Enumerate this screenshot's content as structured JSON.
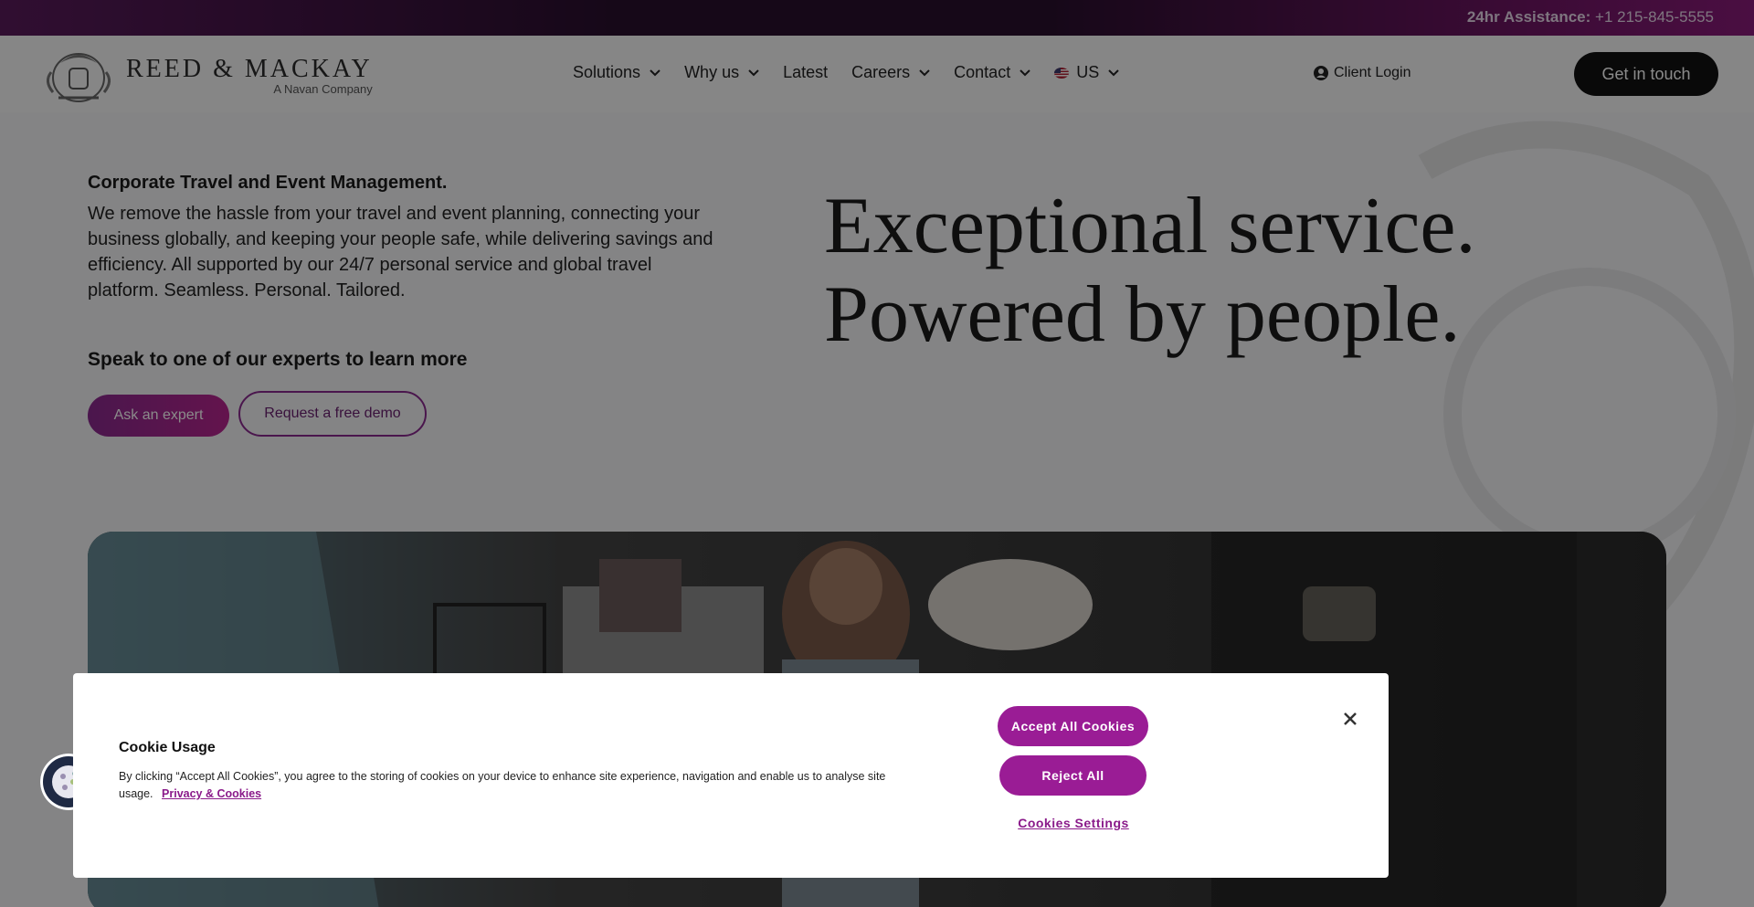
{
  "topbar": {
    "assist_label": "24hr Assistance:",
    "phone": "+1 215-845-5555"
  },
  "header": {
    "brand_name": "REED & MACKAY",
    "brand_sub": "A Navan Company",
    "nav": [
      {
        "label": "Solutions",
        "has_dropdown": true
      },
      {
        "label": "Why us",
        "has_dropdown": true
      },
      {
        "label": "Latest",
        "has_dropdown": false
      },
      {
        "label": "Careers",
        "has_dropdown": true
      },
      {
        "label": "Contact",
        "has_dropdown": true
      },
      {
        "label": "US",
        "has_dropdown": true,
        "icon": "us-flag-icon"
      }
    ],
    "client_login": "Client Login",
    "cta": "Get in touch"
  },
  "hero": {
    "kicker": "Corporate Travel and Event Management.",
    "intro": "We remove the hassle from your travel and event planning, connecting your business globally, and keeping your people safe, while delivering savings and efficiency. All supported by our 24/7 personal service and global travel platform. Seamless. Personal. Tailored.",
    "speak": "Speak to one of our experts to learn more",
    "btn_primary": "Ask an expert",
    "btn_secondary": "Request a free demo",
    "headline_line1": "Exceptional service.",
    "headline_line2": "Powered by people."
  },
  "cookie": {
    "title": "Cookie Usage",
    "text": "By clicking “Accept All Cookies”, you agree to the storing of cookies on your device to enhance site experience, navigation and enable us to analyse site usage.",
    "link": "Privacy & Cookies",
    "accept": "Accept All Cookies",
    "reject": "Reject All",
    "settings": "Cookies Settings"
  },
  "colors": {
    "accent": "#9a1c95",
    "dark": "#111111",
    "topbar": "#2a0f2e"
  }
}
